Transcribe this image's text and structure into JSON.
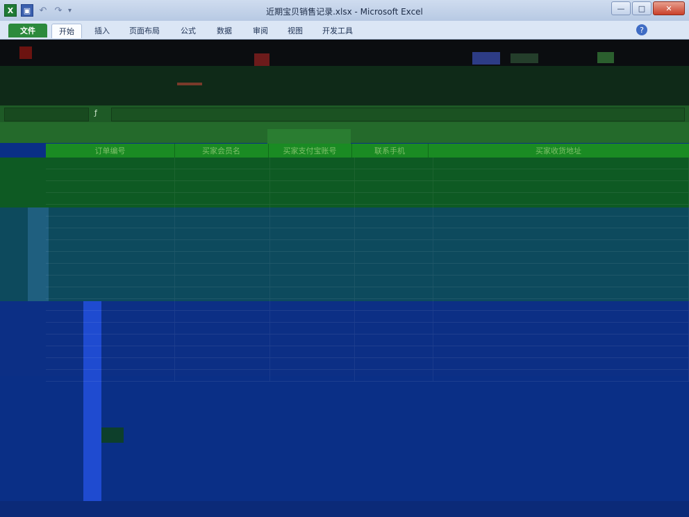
{
  "window": {
    "title": "近期宝贝销售记录.xlsx - Microsoft Excel",
    "file_tab": "文件"
  },
  "ribbon": {
    "tabs": [
      "开始",
      "插入",
      "页面布局",
      "公式",
      "数据",
      "审阅",
      "视图",
      "开发工具"
    ],
    "active_tab": "开始"
  },
  "table": {
    "headers": [
      "订单编号",
      "买家会员名",
      "买家支付宝账号",
      "联系手机",
      "买家收货地址"
    ]
  },
  "colors": {
    "file_tab": "#2c8a3c",
    "ribbon_bg": "#dbe6f5",
    "grid_bg": "#0a2f86",
    "header_green": "#1a8b23"
  }
}
